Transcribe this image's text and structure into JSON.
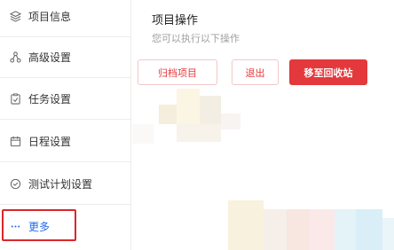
{
  "sidebar": {
    "items": [
      {
        "label": "项目信息",
        "icon": "layers-icon"
      },
      {
        "label": "高级设置",
        "icon": "nodes-icon"
      },
      {
        "label": "任务设置",
        "icon": "clipboard-check-icon"
      },
      {
        "label": "日程设置",
        "icon": "calendar-icon"
      },
      {
        "label": "测试计划设置",
        "icon": "check-circle-icon"
      }
    ],
    "more": {
      "label": "更多",
      "icon": "ellipsis-icon"
    }
  },
  "main": {
    "title": "项目操作",
    "subtitle": "您可以执行以下操作",
    "buttons": {
      "archive": "归档项目",
      "exit": "退出",
      "recycle": "移至回收站"
    }
  },
  "colors": {
    "accent_red": "#e4393c",
    "link_blue": "#2468f2",
    "highlight_outline": "#d9272c"
  }
}
